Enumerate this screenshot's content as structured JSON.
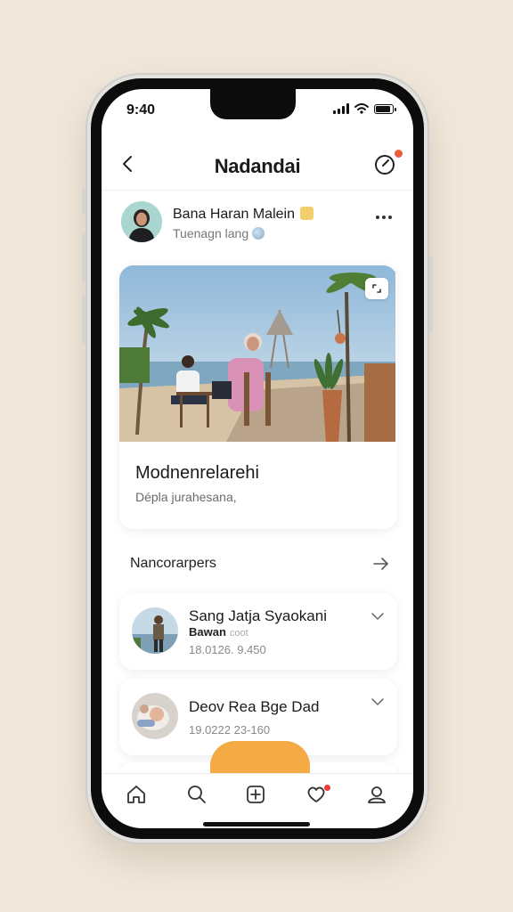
{
  "status_bar": {
    "time": "9:40"
  },
  "nav": {
    "title": "Nadandai"
  },
  "post": {
    "author": "Bana Haran Malein",
    "subtitle": "Tuenagn lang"
  },
  "feature": {
    "title": "Modnenrelarehi",
    "description": "Dépla jurahesana,"
  },
  "section": {
    "label": "Nancorarpers"
  },
  "items": [
    {
      "name": "Sang Jatja Syaokani",
      "role": "Bawan",
      "role_note": "coot",
      "meta": "18.0126. 9.450"
    },
    {
      "name": "Deov Rea Bge Dad",
      "meta": "19.0222 23-160"
    }
  ],
  "colors": {
    "accent": "#f4aa45",
    "badge": "#ee5a3c",
    "background": "#f1e8dc"
  },
  "icons": {
    "back": "back-arrow-icon",
    "compass": "compass-icon",
    "more": "more-dots-icon",
    "arrow": "arrow-right-icon",
    "chevron": "chevron-down-icon",
    "tabs": [
      "home-icon",
      "search-icon",
      "add-post-icon",
      "heart-icon",
      "profile-icon"
    ]
  }
}
